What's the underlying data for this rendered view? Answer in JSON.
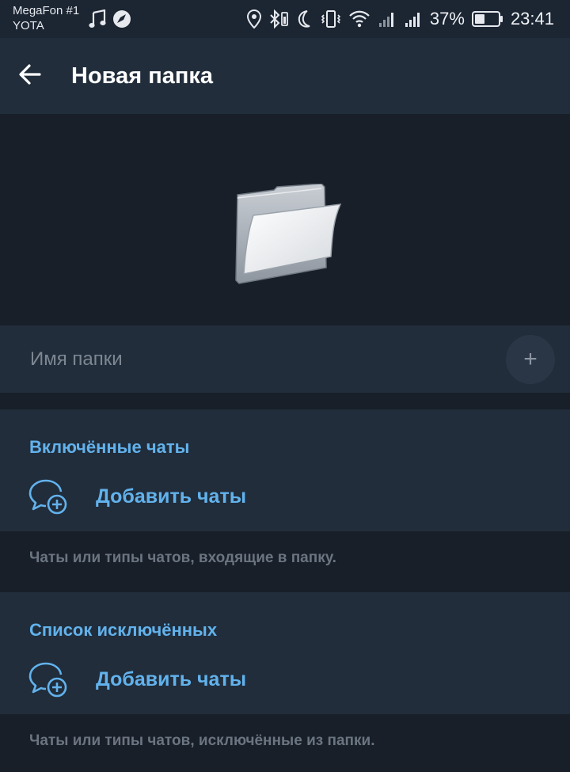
{
  "status_bar": {
    "carrier_line1": "MegaFon #1",
    "carrier_line2": "YOTA",
    "battery": "37%",
    "time": "23:41",
    "left_icons": [
      "music-note-icon",
      "compass-icon"
    ],
    "right_icons": [
      "location-icon",
      "bluetooth-icon",
      "moon-icon",
      "vibrate-icon",
      "wifi-icon",
      "signal-icon",
      "signal-icon",
      "battery-icon"
    ]
  },
  "app_bar": {
    "title": "Новая папка",
    "back_icon": "arrow-left-icon"
  },
  "folder_name": {
    "placeholder": "Имя папки",
    "value": "",
    "add_button": "+"
  },
  "included": {
    "header": "Включённые чаты",
    "add_label": "Добавить чаты",
    "hint": "Чаты или типы чатов, входящие в папку."
  },
  "excluded": {
    "header": "Список исключённых",
    "add_label": "Добавить чаты",
    "hint": "Чаты или типы чатов, исключённые из папки."
  },
  "colors": {
    "accent": "#62b2ec",
    "surface": "#212d3b",
    "background": "#181f29",
    "hint_text": "#6b7581"
  }
}
